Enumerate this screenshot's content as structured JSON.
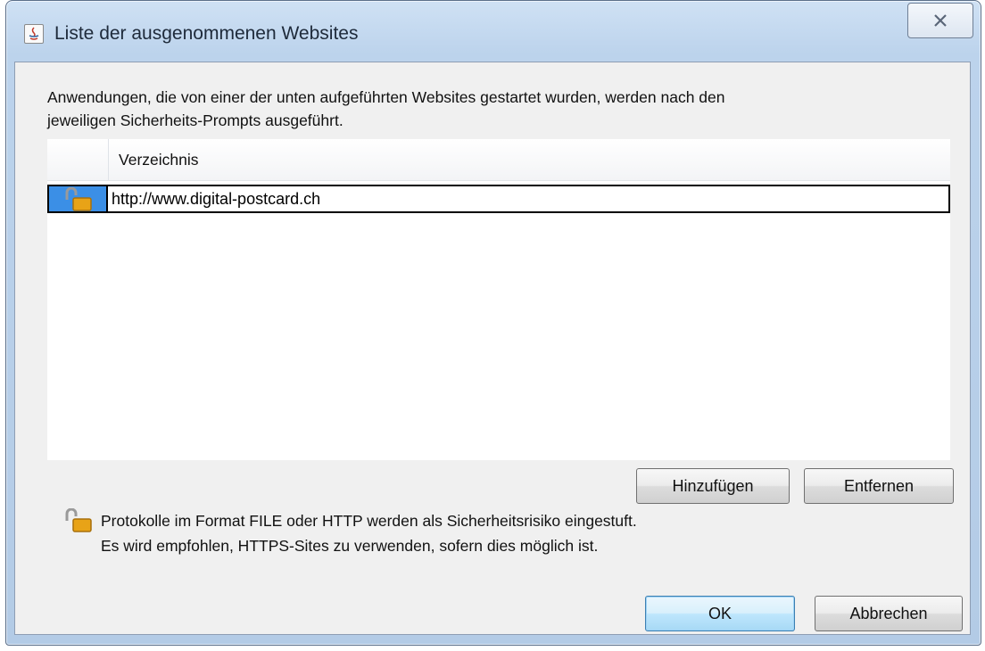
{
  "window": {
    "title": "Liste der ausgenommenen Websites"
  },
  "description": {
    "line1": "Anwendungen, die von einer der unten aufgeführten Websites gestartet wurden, werden nach den",
    "line2": "jeweiligen Sicherheits-Prompts ausgeführt."
  },
  "table": {
    "column_header": "Verzeichnis",
    "rows": [
      {
        "icon": "unlocked-padlock-icon",
        "url": "http://www.digital-postcard.ch"
      }
    ]
  },
  "buttons": {
    "add": "Hinzufügen",
    "remove": "Entfernen",
    "ok": "OK",
    "cancel": "Abbrechen"
  },
  "note": {
    "icon": "unlocked-padlock-icon",
    "line1": "Protokolle im Format FILE oder HTTP werden als Sicherheitsrisiko eingestuft.",
    "line2": "Es wird empfohlen, HTTPS-Sites zu verwenden, sofern dies möglich ist."
  },
  "colors": {
    "selection": "#3b8fe6",
    "window_frame": "#bcd3ec",
    "dialog_bg": "#f0f0f0",
    "default_button": "#bee6fd"
  }
}
